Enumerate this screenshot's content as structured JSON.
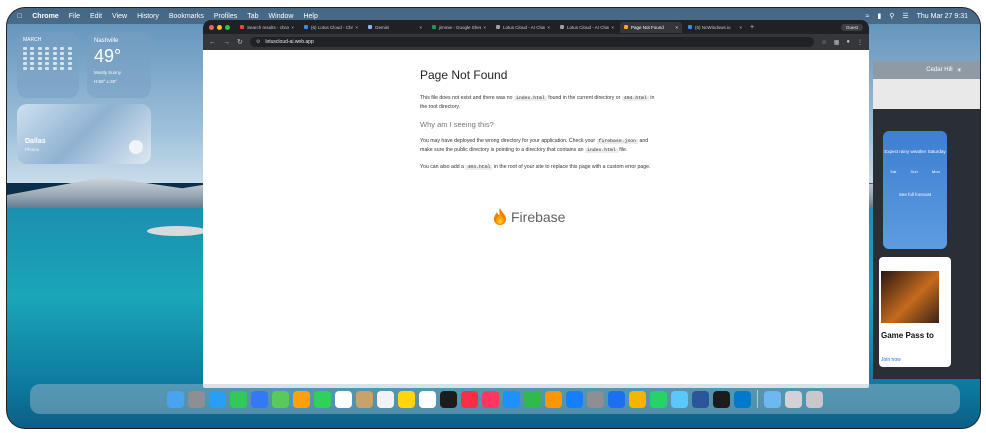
{
  "menubar": {
    "items": [
      "Chrome",
      "File",
      "Edit",
      "View",
      "History",
      "Bookmarks",
      "Profiles",
      "Tab",
      "Window",
      "Help"
    ],
    "clock": "Thu Mar 27 9:31"
  },
  "widgets": {
    "calendar_month": "MARCH",
    "weather": {
      "city": "Nashville",
      "temp": "49°",
      "line1": "Mostly Sunny",
      "line2": "H:60° L:40°"
    },
    "photo": {
      "title": "Dallas",
      "subtitle": "Photos"
    }
  },
  "browser": {
    "tabs": [
      {
        "label": "Search results - chrome",
        "color": "#e8453c"
      },
      {
        "label": "(6) Lotus Cloud - Chrome",
        "color": "#4285f4"
      },
      {
        "label": "Gemini",
        "color": "#8ab4f8"
      },
      {
        "label": "jimmie - Google Sheets",
        "color": "#0f9d58"
      },
      {
        "label": "Lotus Cloud - AI Chat",
        "color": "#9aa0a6"
      },
      {
        "label": "Lotus Cloud - AI Chat",
        "color": "#9aa0a6"
      },
      {
        "label": "Page Not Found",
        "color": "#f5a623"
      },
      {
        "label": "(6) NoWindows.io",
        "color": "#4285f4"
      }
    ],
    "guest_label": "Guest",
    "url": "lotuscloud-ai.web.app",
    "page": {
      "title": "Page Not Found",
      "p1_a": "This file does not exist and there was no",
      "p1_code1": "index.html",
      "p1_b": "found in the current directory or",
      "p1_code2": "404.html",
      "p1_c": "in the root directory.",
      "subtitle": "Why am I seeing this?",
      "p2_a": "You may have deployed the wrong directory for your application. Check your",
      "p2_code1": "firebase.json",
      "p2_b": "and make sure the public directory is pointing to a directory that contains an",
      "p2_code2": "index.html",
      "p2_c": "file.",
      "p3_a": "You can also add a",
      "p3_code": "404.html",
      "p3_b": "in the root of your site to replace this page with a custom error page.",
      "brand": "Firebase"
    }
  },
  "right_window": {
    "header": "Cedar Hill",
    "card_text": "Expect rainy weather Saturday",
    "card_days": [
      "Sat",
      "Sun",
      "Mon"
    ],
    "card_button": "See full forecast",
    "promo_title": "Game Pass to",
    "promo_link": "Join now"
  },
  "dock": {
    "apps": [
      {
        "name": "finder",
        "color": "#4aa3f0"
      },
      {
        "name": "launchpad",
        "color": "#8e8e93"
      },
      {
        "name": "safari",
        "color": "#2a9df4"
      },
      {
        "name": "messages",
        "color": "#34c759"
      },
      {
        "name": "mail",
        "color": "#3478f6"
      },
      {
        "name": "maps",
        "color": "#5ac85a"
      },
      {
        "name": "photos",
        "color": "#ff9f0a"
      },
      {
        "name": "facetime",
        "color": "#30d158"
      },
      {
        "name": "calendar",
        "color": "#ffffff"
      },
      {
        "name": "contacts",
        "color": "#c9a26b"
      },
      {
        "name": "reminders",
        "color": "#f2f2f7"
      },
      {
        "name": "notes",
        "color": "#ffd60a"
      },
      {
        "name": "freeform",
        "color": "#ffffff"
      },
      {
        "name": "tv",
        "color": "#1c1c1e"
      },
      {
        "name": "music",
        "color": "#fa2d48"
      },
      {
        "name": "news",
        "color": "#ff375f"
      },
      {
        "name": "keynote",
        "color": "#1e90ff"
      },
      {
        "name": "numbers",
        "color": "#30b94d"
      },
      {
        "name": "pages",
        "color": "#ff9500"
      },
      {
        "name": "app-store",
        "color": "#147efb"
      },
      {
        "name": "settings",
        "color": "#8e8e93"
      },
      {
        "name": "xcode",
        "color": "#1c6ff0"
      },
      {
        "name": "chrome",
        "color": "#f4b400"
      },
      {
        "name": "whatsapp",
        "color": "#25d366"
      },
      {
        "name": "icloud",
        "color": "#5ac8fa"
      },
      {
        "name": "word",
        "color": "#2b579a"
      },
      {
        "name": "terminal",
        "color": "#1c1c1e"
      },
      {
        "name": "vscode",
        "color": "#007acc"
      },
      {
        "name": "preview",
        "color": "#6cb8f0"
      },
      {
        "name": "downloads",
        "color": "#d1d1d6"
      },
      {
        "name": "trash",
        "color": "#c7c7cc"
      }
    ]
  }
}
